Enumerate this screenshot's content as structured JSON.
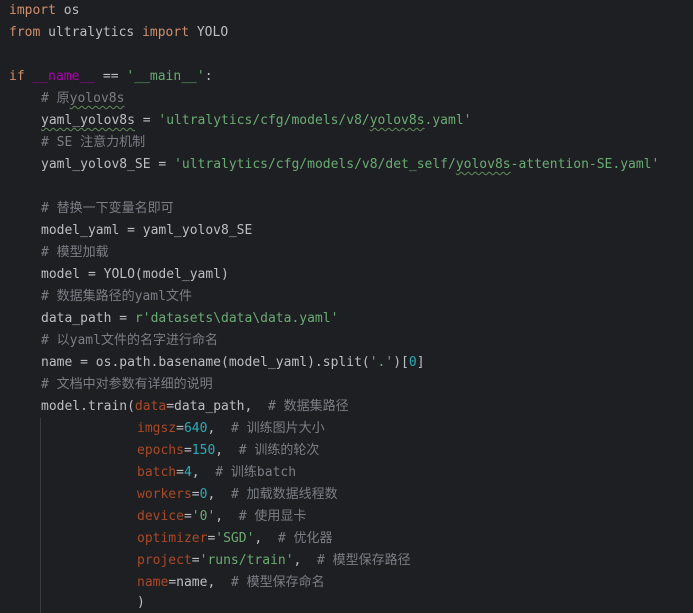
{
  "code": {
    "l1": {
      "kw1": "import",
      "rest": " os"
    },
    "l2": {
      "kw1": "from",
      "mid": " ultralytics ",
      "kw2": "import",
      "rest": " YOLO"
    },
    "l4": {
      "kw1": "if",
      "sp": " ",
      "name": "__name__",
      "op": " == ",
      "str": "'__main__'",
      "colon": ":"
    },
    "l5": {
      "cmt_a": "# 原",
      "cmt_b": "yolov8s"
    },
    "l6": {
      "var": "yaml_yolov8s",
      "op": " = ",
      "str_a": "'ultralytics/cfg/models/v8/",
      "str_b": "yolov8s",
      "str_c": ".yaml'"
    },
    "l7": {
      "cmt": "# SE 注意力机制"
    },
    "l8": {
      "var": "yaml_yolov8_SE",
      "op": " = ",
      "str_a": "'ultralytics/cfg/models/v8/det_self/",
      "str_b": "yolov8s",
      "str_c": "-attention-SE.yaml'"
    },
    "l10": {
      "cmt": "# 替换一下变量名即可"
    },
    "l11": {
      "text": "model_yaml = yaml_yolov8_SE"
    },
    "l12": {
      "cmt": "# 模型加载"
    },
    "l13": {
      "text": "model = YOLO(model_yaml)"
    },
    "l14": {
      "cmt": "# 数据集路径的yaml文件"
    },
    "l15": {
      "pre": "data_path = ",
      "str": "r'datasets\\data\\data.yaml'"
    },
    "l16": {
      "cmt": "# 以yaml文件的名字进行命名"
    },
    "l17": {
      "pre": "name = os.path.basename(model_yaml).split(",
      "str": "'.'",
      "mid": ")[",
      "num": "0",
      "post": "]"
    },
    "l18": {
      "cmt": "# 文档中对参数有详细的说明"
    },
    "l19": {
      "pre": "model.train(",
      "param": "data",
      "mid": "=data_path,  ",
      "cmt": "# 数据集路径"
    },
    "l20": {
      "param": "imgsz",
      "eq": "=",
      "num": "640",
      "sep": ",  ",
      "cmt": "# 训练图片大小"
    },
    "l21": {
      "param": "epochs",
      "eq": "=",
      "num": "150",
      "sep": ",  ",
      "cmt": "# 训练的轮次"
    },
    "l22": {
      "param": "batch",
      "eq": "=",
      "num": "4",
      "sep": ",  ",
      "cmt": "# 训练batch"
    },
    "l23": {
      "param": "workers",
      "eq": "=",
      "num": "0",
      "sep": ",  ",
      "cmt": "# 加载数据线程数"
    },
    "l24": {
      "param": "device",
      "eq": "=",
      "str": "'0'",
      "sep": ",  ",
      "cmt": "# 使用显卡"
    },
    "l25": {
      "param": "optimizer",
      "eq": "=",
      "str": "'SGD'",
      "sep": ",  ",
      "cmt": "# 优化器"
    },
    "l26": {
      "param": "project",
      "eq": "=",
      "str": "'runs/train'",
      "sep": ",  ",
      "cmt": "# 模型保存路径"
    },
    "l27": {
      "param": "name",
      "eq": "=name,  ",
      "cmt": "# 模型保存命名"
    },
    "l28": {
      "text": ")"
    }
  }
}
